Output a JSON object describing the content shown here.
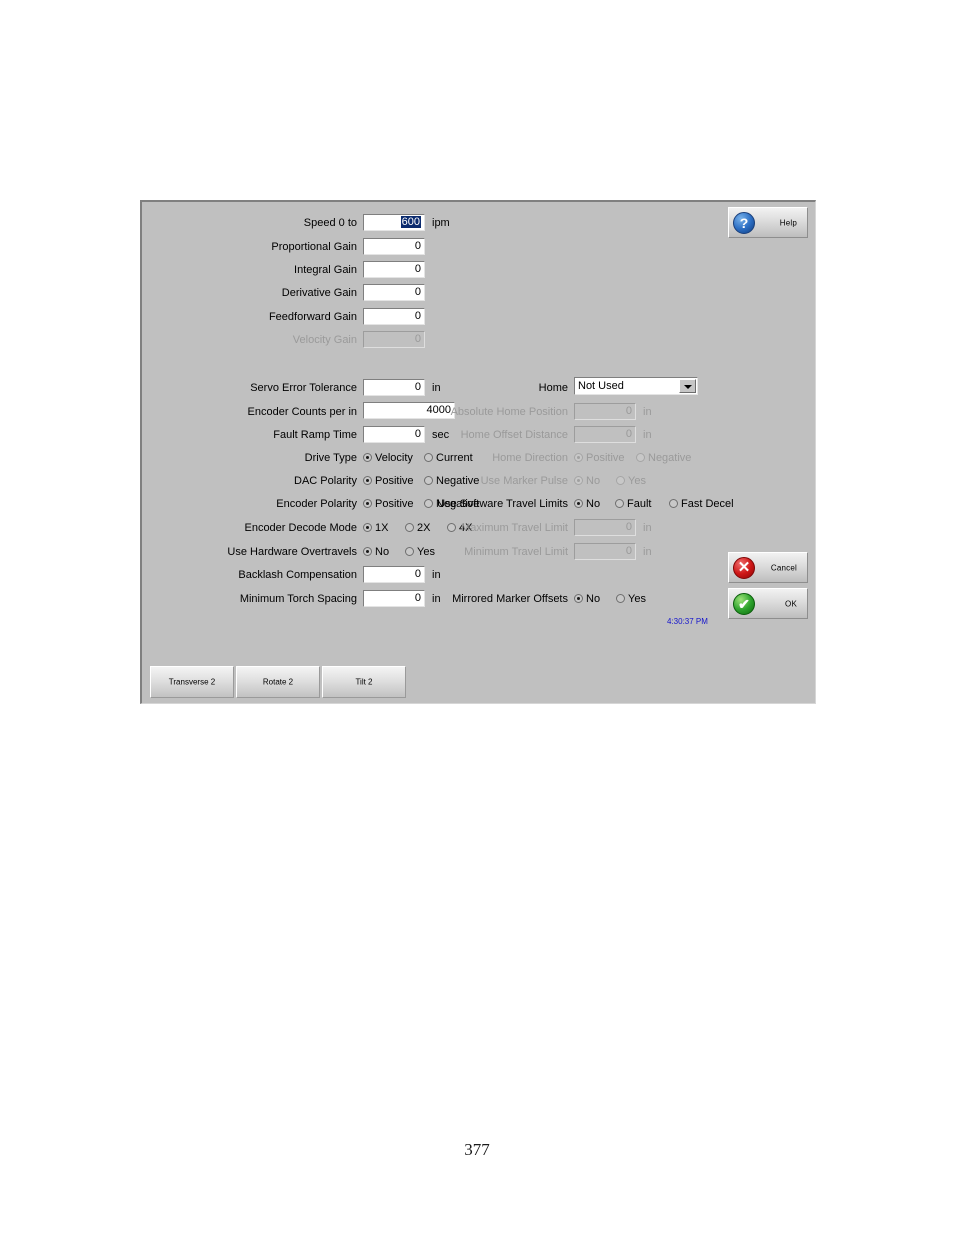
{
  "page": {
    "number": "377"
  },
  "dialog": {
    "help_button": {
      "label": "Help",
      "icon": "question-mark-icon"
    },
    "cancel_button": {
      "label": "Cancel",
      "icon": "red-x-circle-icon"
    },
    "ok_button": {
      "label": "OK",
      "icon": "green-check-circle-icon"
    },
    "timestamp": "4:30:37 PM",
    "accent_selection_color": "#0a2a6e",
    "timestamp_color": "#1414cc",
    "background_color": "#c0c0c0"
  },
  "gains": {
    "speed": {
      "label": "Speed  0  to",
      "value": "600",
      "unit": "ipm",
      "selected": true
    },
    "proportional": {
      "label": "Proportional Gain",
      "value": "0",
      "unit": ""
    },
    "integral": {
      "label": "Integral Gain",
      "value": "0",
      "unit": ""
    },
    "derivative": {
      "label": "Derivative Gain",
      "value": "0",
      "unit": ""
    },
    "feedforward": {
      "label": "Feedforward Gain",
      "value": "0",
      "unit": ""
    },
    "velocity": {
      "label": "Velocity Gain",
      "value": "0",
      "unit": "",
      "disabled": true
    }
  },
  "left_column": {
    "servo_error_tolerance": {
      "label": "Servo Error Tolerance",
      "value": "0",
      "unit": "in"
    },
    "encoder_counts_per_in": {
      "label": "Encoder Counts per in",
      "value": "4000",
      "unit": ""
    },
    "fault_ramp_time": {
      "label": "Fault Ramp Time",
      "value": "0",
      "unit": "sec"
    },
    "drive_type": {
      "label": "Drive Type",
      "options": [
        "Velocity",
        "Current"
      ],
      "selected": "Velocity"
    },
    "dac_polarity": {
      "label": "DAC Polarity",
      "options": [
        "Positive",
        "Negative"
      ],
      "selected": "Positive"
    },
    "encoder_polarity": {
      "label": "Encoder Polarity",
      "options": [
        "Positive",
        "Negative"
      ],
      "selected": "Positive"
    },
    "encoder_decode_mode": {
      "label": "Encoder Decode Mode",
      "options": [
        "1X",
        "2X",
        "4X"
      ],
      "selected": "1X"
    },
    "use_hardware_overtravels": {
      "label": "Use Hardware Overtravels",
      "options": [
        "No",
        "Yes"
      ],
      "selected": "No"
    },
    "backlash_compensation": {
      "label": "Backlash Compensation",
      "value": "0",
      "unit": "in"
    },
    "minimum_torch_spacing": {
      "label": "Minimum Torch Spacing",
      "value": "0",
      "unit": "in"
    }
  },
  "right_column": {
    "home": {
      "label": "Home",
      "value": "Not Used",
      "options": [
        "Not Used"
      ]
    },
    "absolute_home_position": {
      "label": "Absolute Home Position",
      "value": "0",
      "unit": "in",
      "disabled": true
    },
    "home_offset_distance": {
      "label": "Home Offset Distance",
      "value": "0",
      "unit": "in",
      "disabled": true
    },
    "home_direction": {
      "label": "Home Direction",
      "options": [
        "Positive",
        "Negative"
      ],
      "selected": "Positive",
      "disabled": true
    },
    "use_marker_pulse": {
      "label": "Use Marker Pulse",
      "options": [
        "No",
        "Yes"
      ],
      "selected": "No",
      "disabled": true
    },
    "use_software_travel_limits": {
      "label": "Use Software Travel Limits",
      "options": [
        "No",
        "Fault",
        "Fast Decel"
      ],
      "selected": "No"
    },
    "maximum_travel_limit": {
      "label": "Maximum Travel Limit",
      "value": "0",
      "unit": "in",
      "disabled": true
    },
    "minimum_travel_limit": {
      "label": "Minimum Travel Limit",
      "value": "0",
      "unit": "in",
      "disabled": true
    },
    "mirrored_marker_offsets": {
      "label": "Mirrored Marker Offsets",
      "options": [
        "No",
        "Yes"
      ],
      "selected": "No"
    }
  },
  "bottom_tabs": [
    {
      "label": "Transverse 2"
    },
    {
      "label": "Rotate 2"
    },
    {
      "label": "Tilt 2"
    }
  ]
}
